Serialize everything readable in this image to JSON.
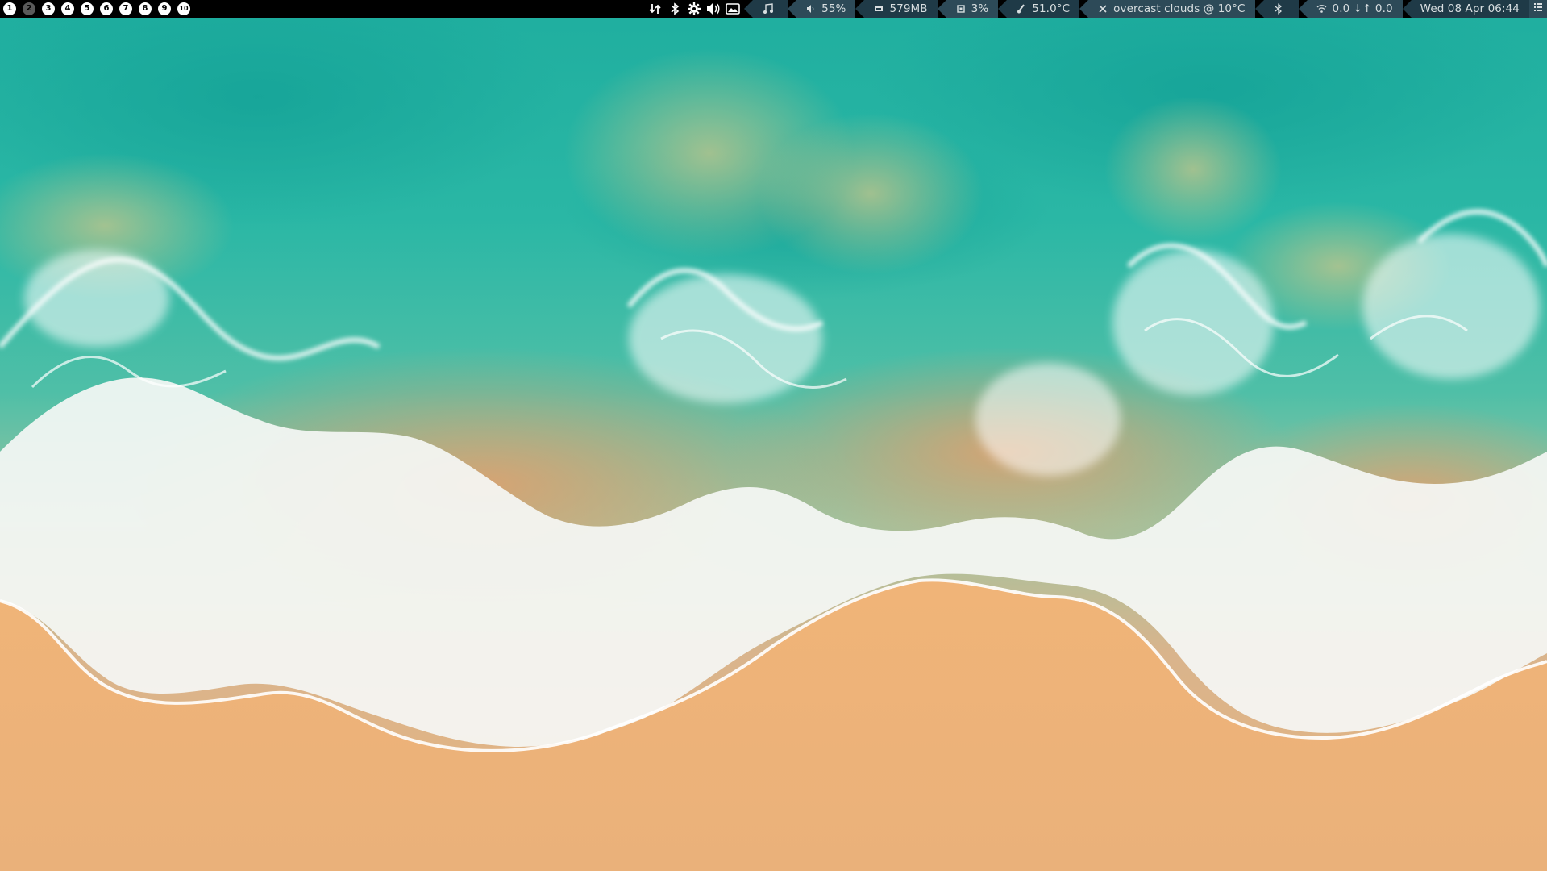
{
  "workspaces": [
    "1",
    "2",
    "3",
    "4",
    "5",
    "6",
    "7",
    "8",
    "9",
    "10"
  ],
  "active_workspace": "2",
  "tray_icons": [
    "network-arrows-icon",
    "bluetooth-icon",
    "settings-gear-icon",
    "volume-icon",
    "image-viewer-icon"
  ],
  "status": {
    "music_icon": "music-note-icon",
    "volume": "55%",
    "memory": "579MB",
    "cpu": "3%",
    "temperature": "51.0°C",
    "weather": "overcast clouds @ 10°C",
    "bluetooth_icon": "bluetooth-icon",
    "network": "0.0 ↓↑ 0.0",
    "datetime": "Wed 08 Apr 06:44",
    "menu_icon": "menu-list-icon"
  },
  "colors": {
    "bar_background": "#000000",
    "segment_dark": "#1f3a47",
    "segment_light": "#2d4a58",
    "sea_turquoise": "#2ab3a6",
    "sand": "#ebb47c",
    "foam": "#f4f6f4"
  }
}
